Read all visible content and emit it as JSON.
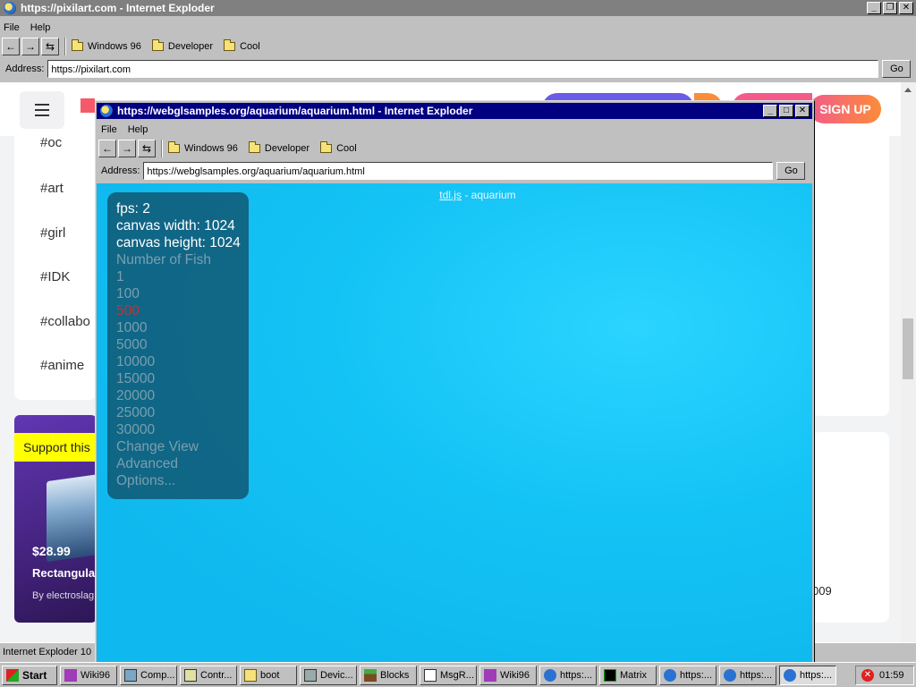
{
  "outer_window": {
    "title": "https://pixilart.com - Internet Exploder",
    "menu": [
      "File",
      "Help"
    ],
    "favorites": [
      "Windows 96",
      "Developer",
      "Cool"
    ],
    "address_label": "Address:",
    "address_value": "https://pixilart.com",
    "go_label": "Go",
    "status_text": "Internet Exploder 10"
  },
  "pixilart": {
    "signup_label": "SIGN UP",
    "tags": [
      "#oc",
      "#art",
      "#girl",
      "#IDK",
      "#collabo",
      "#anime"
    ],
    "support_label": "Support this",
    "price": "$28.99",
    "product_name": "Rectangula",
    "product_by": "By electroslag",
    "right_number": "009"
  },
  "inner_window": {
    "title": "https://webglsamples.org/aquarium/aquarium.html - Internet Exploder",
    "menu": [
      "File",
      "Help"
    ],
    "favorites": [
      "Windows 96",
      "Developer",
      "Cool"
    ],
    "address_label": "Address:",
    "address_value": "https://webglsamples.org/aquarium/aquarium.html",
    "go_label": "Go"
  },
  "aquarium": {
    "link_text": "tdl.js",
    "title_suffix": " - aquarium",
    "fps": "fps: 2",
    "canvas_width": "canvas width: 1024",
    "canvas_height": "canvas height: 1024",
    "number_of_fish_label": "Number of Fish",
    "fish_options": [
      "1",
      "100",
      "500",
      "1000",
      "5000",
      "10000",
      "15000",
      "20000",
      "25000",
      "30000"
    ],
    "selected_fish": "500",
    "change_view": "Change View",
    "advanced": "Advanced",
    "options": "Options..."
  },
  "taskbar": {
    "start_label": "Start",
    "items": [
      "Wiki96",
      "Comp...",
      "Contr...",
      "boot",
      "Devic...",
      "Blocks",
      "MsgR...",
      "Wiki96",
      "https:...",
      "Matrix",
      "https:...",
      "https:...",
      "https:..."
    ],
    "clock": "01:59"
  },
  "colors": {
    "title_active": "#000080",
    "title_inactive": "#808080",
    "aquarium_blue": "#14c3f5",
    "selected_option": "#c43232"
  }
}
